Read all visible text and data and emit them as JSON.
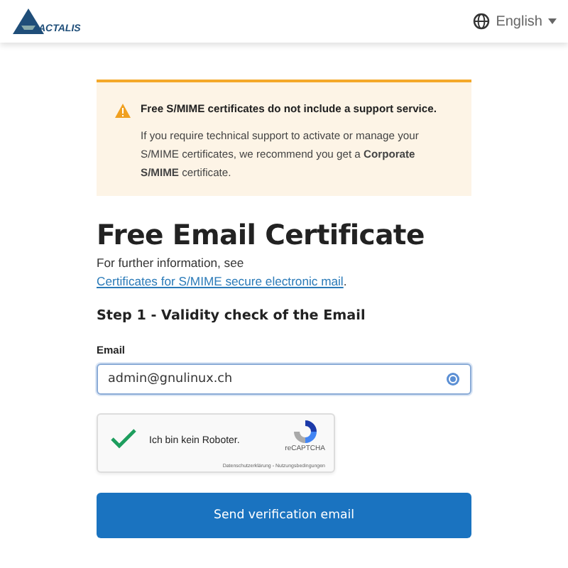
{
  "header": {
    "logo": "ACTALIS",
    "language": "English"
  },
  "alert": {
    "title": "Free S/MIME certificates do not include a support service.",
    "body": "If you require technical support to activate or manage your S/MIME certificates, we recommend you get a **Corporate S/MIME** certificate."
  },
  "title": "Free Email Certificate",
  "intro": {
    "text": "For further information, see ",
    "link": "Certificates for S/MIME secure electronic mail",
    "after": "."
  },
  "step": "Step 1 - Validity check of the Email",
  "email": {
    "label": "Email",
    "value": "admin@gnulinux.ch"
  },
  "captcha": {
    "label": "Ich bin kein Roboter.",
    "checked": true,
    "brand": "reCAPTCHA",
    "links": "Datenschutzerklärung - Nutzungsbedingungen"
  },
  "button": "Send verification email"
}
